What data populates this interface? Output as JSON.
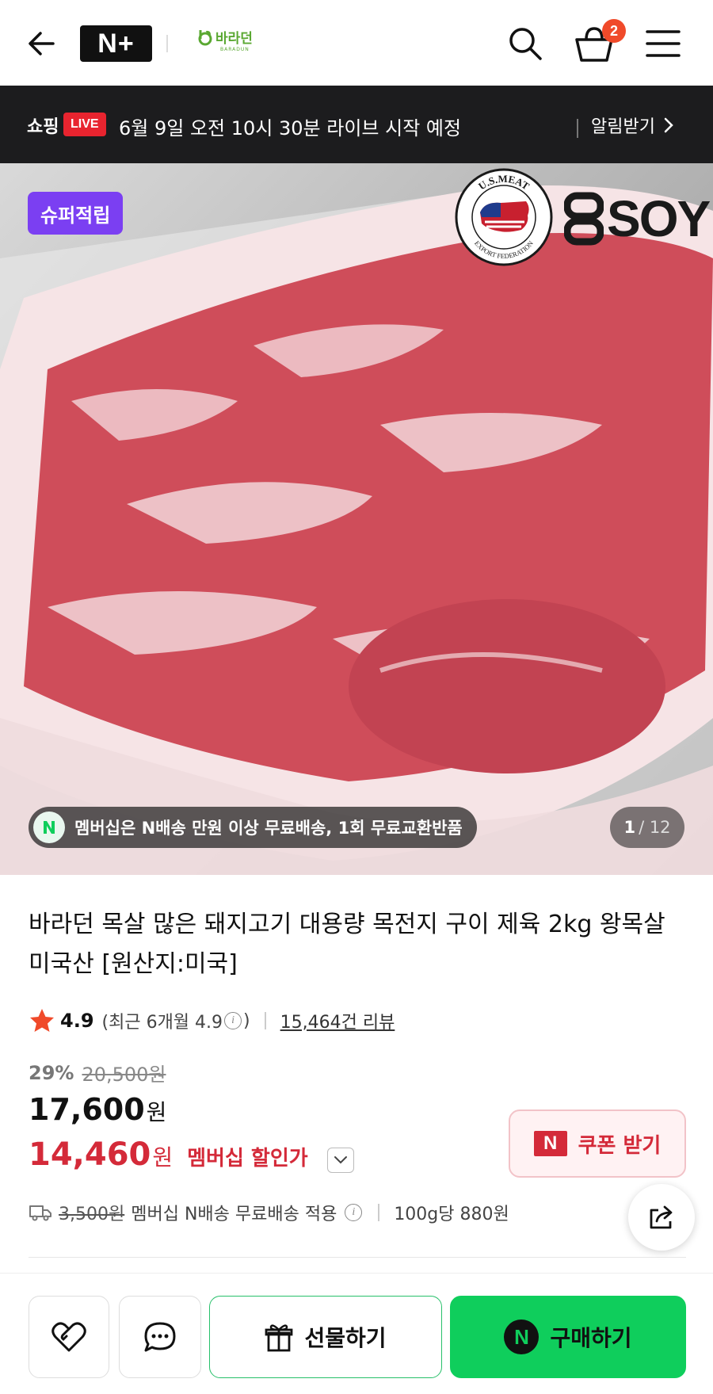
{
  "header": {
    "nplus_label": "N+",
    "brand_name": "바라던",
    "brand_sub": "BARADUN",
    "cart_count": "2",
    "icons": [
      "back-arrow-icon",
      "search-icon",
      "cart-icon",
      "menu-icon"
    ]
  },
  "live_bar": {
    "label": "쇼핑",
    "badge": "LIVE",
    "text": "6월 9일 오전 10시 30분 라이브 시작 예정",
    "alarm": "알림받기"
  },
  "hero": {
    "super_badge": "슈퍼적립",
    "usmeat_top": "U.S.MEAT",
    "usmeat_bottom": "EXPORT FEDERATION",
    "soy_text": "SOY",
    "soy_mark": "US",
    "member_notice": "멤버십은 N배송 만원 이상 무료배송, 1회 무료교환반품",
    "page_current": "1",
    "page_total": "/ 12"
  },
  "product": {
    "title": "바라던 목살 많은 돼지고기 대용량 목전지 구이 제육 2kg 왕목살 미국산 [원산지:미국]",
    "rating": "4.9",
    "rating_recent_pre": "(최근 6개월 4.9",
    "rating_recent_post": ")",
    "reviews": "15,464건 리뷰",
    "discount_pct": "29%",
    "original_price": "20,500원",
    "price": "17,600",
    "price_unit": "원",
    "member_price": "14,460",
    "member_price_unit": "원",
    "member_price_label": "멤버십 할인가",
    "coupon_label": "쿠폰 받기",
    "coupon_logo": "N",
    "ship_original": "3,500원",
    "ship_text": "멤버십 N배송 무료배송 적용",
    "unit_price": "100g당 880원"
  },
  "bottom_bar": {
    "gift_label": "선물하기",
    "buy_label": "구매하기",
    "buy_logo": "N"
  },
  "colors": {
    "accent_green": "#0fce5c",
    "sale_red": "#d42a39",
    "super_purple": "#7b3ff2",
    "live_red": "#e8242f",
    "badge_orange": "#f04a2a"
  }
}
